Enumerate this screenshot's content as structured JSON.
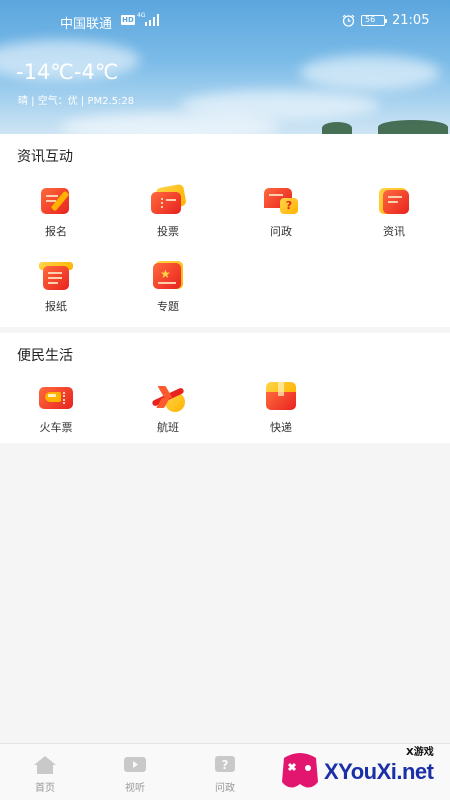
{
  "status_bar": {
    "carrier": "中国联通",
    "hd": "HD",
    "network": "4G",
    "battery": "56",
    "time": "21:05"
  },
  "weather": {
    "temperature": "-14℃-4℃",
    "detail": "晴 | 空气：优 | PM2.5:28"
  },
  "sections": [
    {
      "title": "资讯互动",
      "items": [
        {
          "label": "报名",
          "icon": "signup-icon"
        },
        {
          "label": "投票",
          "icon": "vote-ticket-icon"
        },
        {
          "label": "问政",
          "icon": "question-chat-icon"
        },
        {
          "label": "资讯",
          "icon": "news-icon"
        },
        {
          "label": "报纸",
          "icon": "newspaper-icon"
        },
        {
          "label": "专题",
          "icon": "topic-star-icon"
        }
      ]
    },
    {
      "title": "便民生活",
      "items": [
        {
          "label": "火车票",
          "icon": "train-ticket-icon"
        },
        {
          "label": "航班",
          "icon": "airplane-icon"
        },
        {
          "label": "快递",
          "icon": "package-icon"
        }
      ]
    }
  ],
  "bottom_nav": [
    {
      "label": "首页",
      "icon": "home-icon"
    },
    {
      "label": "视听",
      "icon": "video-icon"
    },
    {
      "label": "问政",
      "icon": "question-icon"
    }
  ],
  "watermark": {
    "brand": "XYouXi.net",
    "tag": "X游戏"
  },
  "colors": {
    "accent_red": "#e8221f",
    "accent_yellow": "#ffb300",
    "nav_inactive": "#999999"
  }
}
